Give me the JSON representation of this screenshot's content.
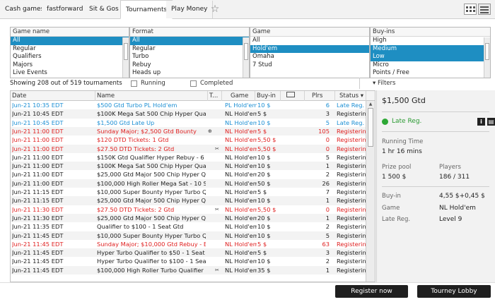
{
  "tabs": [
    {
      "label": "Cash games"
    },
    {
      "label": "fastforward"
    },
    {
      "label": "Sit & Gos"
    },
    {
      "label": "Tournaments"
    },
    {
      "label": "Play Money"
    }
  ],
  "filters": {
    "game_name": {
      "header": "Game name",
      "options": [
        "All",
        "Regular",
        "Qualifiers",
        "Majors",
        "Live Events"
      ],
      "selected": 0
    },
    "format": {
      "header": "Format",
      "options": [
        "All",
        "Regular",
        "Turbo",
        "Rebuy",
        "Heads up"
      ],
      "selected": 0
    },
    "game": {
      "header": "Game",
      "options": [
        "All",
        "Hold'em",
        "Omaha",
        "7 Stud"
      ],
      "selected": 1
    },
    "buyins": {
      "header": "Buy-ins",
      "options": [
        "High",
        "Medium",
        "Low",
        "Micro",
        "Points / Free"
      ],
      "selected": [
        1,
        2
      ]
    }
  },
  "summary": {
    "showing": "Showing 208 out of 519 tournaments",
    "running": "Running",
    "completed": "Completed",
    "filters": "Filters"
  },
  "columns": {
    "date": "Date",
    "name": "Name",
    "type": "T...",
    "game": "Game",
    "buyin": "Buy-in",
    "plrs": "Plrs",
    "status": "Status"
  },
  "rows": [
    {
      "date": "Jun-21 10:35 EDT",
      "name": "$500 Gtd Turbo PL Hold'em",
      "icon": "",
      "game": "PL Hold'em",
      "buyin": "10 $",
      "plrs": "6",
      "status": "Late Reg.",
      "color": "#1b8fd4",
      "alt": false
    },
    {
      "date": "Jun-21 10:45 EDT",
      "name": "$100K Mega Sat 500 Chip Hyper Quali...",
      "icon": "",
      "game": "NL Hold'em",
      "buyin": "5 $",
      "plrs": "3",
      "status": "Registering",
      "color": "#222222",
      "alt": true
    },
    {
      "date": "Jun-21 10:45 EDT",
      "name": "$1,500 Gtd Late Up",
      "icon": "",
      "game": "NL Hold'em",
      "buyin": "10 $",
      "plrs": "5",
      "status": "Late Reg.",
      "color": "#1b8fd4",
      "alt": false
    },
    {
      "date": "Jun-21 11:00 EDT",
      "name": "Sunday Major; $2,500 Gtd Bounty",
      "icon": "bounty",
      "game": "NL Hold'em",
      "buyin": "5 $",
      "plrs": "105",
      "status": "Registering",
      "color": "#e02020",
      "alt": true
    },
    {
      "date": "Jun-21 11:00 EDT",
      "name": "$120 DTD Tickets: 1 Gtd",
      "icon": "",
      "game": "NL Hold'em",
      "buyin": "5,50 $",
      "plrs": "0",
      "status": "Registering",
      "color": "#e02020",
      "alt": false
    },
    {
      "date": "Jun-21 11:00 EDT",
      "name": "$27.50 DTD Tickets: 2 Gtd",
      "icon": "ticket",
      "game": "NL Hold'em",
      "buyin": "5,50 $",
      "plrs": "0",
      "status": "Registering",
      "color": "#e02020",
      "alt": true
    },
    {
      "date": "Jun-21 11:00 EDT",
      "name": "$150K Gtd Qualifier Hyper Rebuy - 6 ...",
      "icon": "",
      "game": "NL Hold'em",
      "buyin": "10 $",
      "plrs": "5",
      "status": "Registering",
      "color": "#222222",
      "alt": false
    },
    {
      "date": "Jun-21 11:00 EDT",
      "name": "$100K Mega Sat 500 Chip Hyper Quali...",
      "icon": "",
      "game": "NL Hold'em",
      "buyin": "10 $",
      "plrs": "1",
      "status": "Registering",
      "color": "#222222",
      "alt": true
    },
    {
      "date": "Jun-21 11:00 EDT",
      "name": "$25,000 Gtd Major 500 Chip Hyper Q...",
      "icon": "",
      "game": "NL Hold'em",
      "buyin": "20 $",
      "plrs": "2",
      "status": "Registering",
      "color": "#222222",
      "alt": false
    },
    {
      "date": "Jun-21 11:00 EDT",
      "name": "$100,000 High Roller Mega Sat - 10 Se...",
      "icon": "",
      "game": "NL Hold'em",
      "buyin": "50 $",
      "plrs": "26",
      "status": "Registering",
      "color": "#222222",
      "alt": true
    },
    {
      "date": "Jun-21 11:15 EDT",
      "name": "$10,000 Super Bounty Hyper Turbo Q...",
      "icon": "",
      "game": "NL Hold'em",
      "buyin": "5 $",
      "plrs": "7",
      "status": "Registering",
      "color": "#222222",
      "alt": false
    },
    {
      "date": "Jun-21 11:15 EDT",
      "name": "$25,000 Gtd Major 500 Chip Hyper Q...",
      "icon": "",
      "game": "NL Hold'em",
      "buyin": "10 $",
      "plrs": "1",
      "status": "Registering",
      "color": "#222222",
      "alt": true
    },
    {
      "date": "Jun-21 11:30 EDT",
      "name": "$27.50 DTD Tickets: 2 Gtd",
      "icon": "ticket",
      "game": "NL Hold'em",
      "buyin": "5,50 $",
      "plrs": "0",
      "status": "Registering",
      "color": "#e02020",
      "alt": false
    },
    {
      "date": "Jun-21 11:30 EDT",
      "name": "$25,000 Gtd Major 500 Chip Hyper Q...",
      "icon": "",
      "game": "NL Hold'em",
      "buyin": "20 $",
      "plrs": "1",
      "status": "Registering",
      "color": "#222222",
      "alt": true
    },
    {
      "date": "Jun-21 11:35 EDT",
      "name": "Qualifier to $100 - 1 Seat Gtd",
      "icon": "",
      "game": "NL Hold'em",
      "buyin": "10 $",
      "plrs": "2",
      "status": "Registering",
      "color": "#222222",
      "alt": false
    },
    {
      "date": "Jun-21 11:45 EDT",
      "name": "$10,000 Super Bounty Hyper Turbo Q...",
      "icon": "",
      "game": "NL Hold'em",
      "buyin": "10 $",
      "plrs": "5",
      "status": "Registering",
      "color": "#222222",
      "alt": true
    },
    {
      "date": "Jun-21 11:45 EDT",
      "name": "Sunday Major; $10,000 Gtd Rebuy - B...",
      "icon": "",
      "game": "NL Hold'em",
      "buyin": "5 $",
      "plrs": "63",
      "status": "Registering",
      "color": "#e02020",
      "alt": false
    },
    {
      "date": "Jun-21 11:45 EDT",
      "name": "Hyper Turbo Qualifier to $50 - 1 Seat ...",
      "icon": "",
      "game": "NL Hold'em",
      "buyin": "5 $",
      "plrs": "3",
      "status": "Registering",
      "color": "#222222",
      "alt": true
    },
    {
      "date": "Jun-21 11:45 EDT",
      "name": "Hyper Turbo Qualifier to $100 - 1 Seat ...",
      "icon": "",
      "game": "NL Hold'em",
      "buyin": "10 $",
      "plrs": "2",
      "status": "Registering",
      "color": "#222222",
      "alt": false
    },
    {
      "date": "Jun-21 11:45 EDT",
      "name": "$100,000 High Roller Turbo Qualifier [...",
      "icon": "ticket",
      "game": "NL Hold'em",
      "buyin": "35 $",
      "plrs": "1",
      "status": "Registering",
      "color": "#222222",
      "alt": true
    }
  ],
  "detail": {
    "title": "$1,500 Gtd",
    "late_reg": "Late Reg.",
    "running_time_label": "Running Time",
    "running_time": "1 hr  16 mins",
    "prize_pool_label": "Prize pool",
    "prize_pool": "1 500 $",
    "players_label": "Players",
    "players": "186 / 311",
    "buyin_label": "Buy-in",
    "buyin": "4,55 $+0,45 $",
    "game_label": "Game",
    "game": "NL Hold'em",
    "latereg_label": "Late Reg.",
    "latereg": "Level 9"
  },
  "buttons": {
    "register": "Register now",
    "lobby": "Tourney Lobby"
  },
  "colors": {
    "selected_bg": "#1e8ec2",
    "late_reg": "#1b8fd4",
    "major": "#e02020",
    "status_green": "#2ea836"
  }
}
